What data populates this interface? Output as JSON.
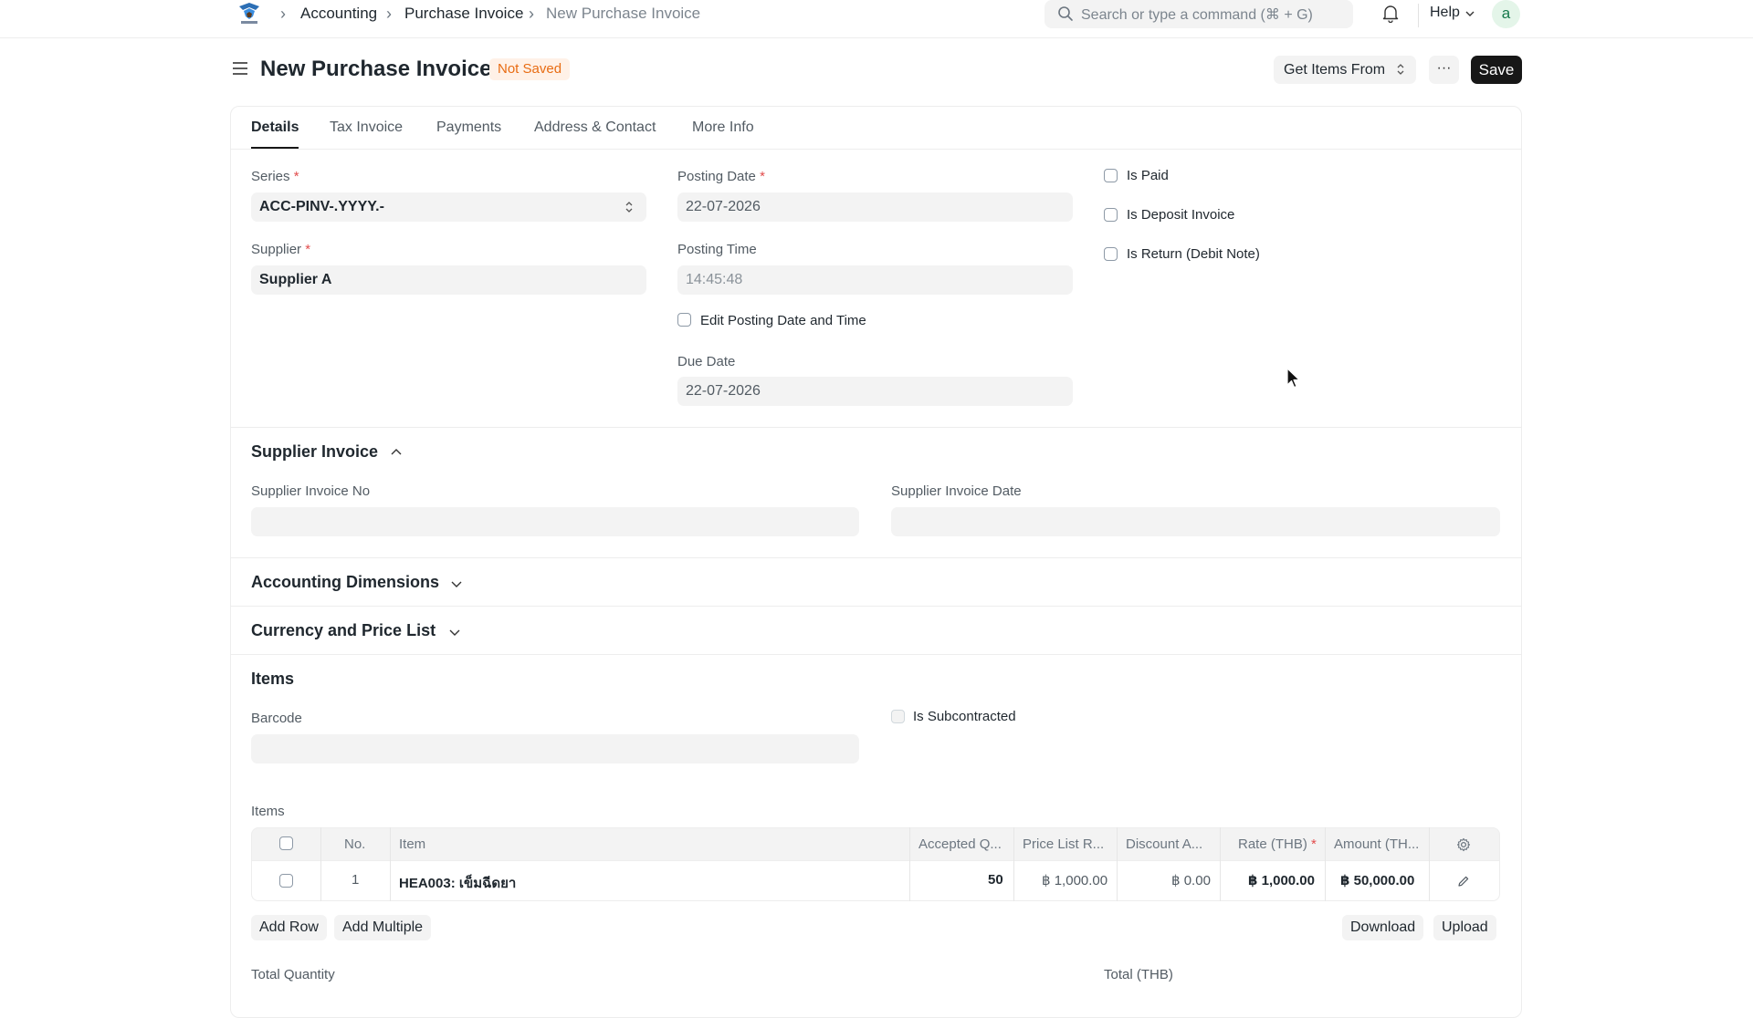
{
  "navbar": {
    "breadcrumbs": [
      "Accounting",
      "Purchase Invoice",
      "New Purchase Invoice"
    ],
    "search_placeholder": "Search or type a command (⌘ + G)",
    "help_label": "Help",
    "avatar_letter": "a"
  },
  "page": {
    "title": "New Purchase Invoice",
    "status": "Not Saved",
    "get_items_label": "Get Items From",
    "more_label": "···",
    "save_label": "Save"
  },
  "tabs": [
    "Details",
    "Tax Invoice",
    "Payments",
    "Address & Contact",
    "More Info"
  ],
  "details": {
    "series_label": "Series",
    "series_value": "ACC-PINV-.YYYY.-",
    "supplier_label": "Supplier",
    "supplier_value": "Supplier A",
    "posting_date_label": "Posting Date",
    "posting_date_value": "22-07-2026",
    "posting_time_label": "Posting Time",
    "posting_time_value": "14:45:48",
    "edit_posting_label": "Edit Posting Date and Time",
    "due_date_label": "Due Date",
    "due_date_value": "22-07-2026",
    "is_paid_label": "Is Paid",
    "is_deposit_label": "Is Deposit Invoice",
    "is_return_label": "Is Return (Debit Note)"
  },
  "supplier_invoice": {
    "title": "Supplier Invoice",
    "no_label": "Supplier Invoice No",
    "date_label": "Supplier Invoice Date"
  },
  "sections": {
    "accounting_dimensions": "Accounting Dimensions",
    "currency_price_list": "Currency and Price List",
    "items": "Items"
  },
  "items_section": {
    "barcode_label": "Barcode",
    "subcontracted_label": "Is Subcontracted",
    "table_label": "Items",
    "columns": [
      "No.",
      "Item",
      "Accepted Q...",
      "Price List R...",
      "Discount A...",
      "Rate (THB)",
      "Amount (TH..."
    ],
    "rows": [
      {
        "no": "1",
        "item": "HEA003: เข็มฉีดยา",
        "accepted_qty": "50",
        "price_list_rate": "฿ 1,000.00",
        "discount_amount": "฿ 0.00",
        "rate": "฿ 1,000.00",
        "amount": "฿ 50,000.00"
      }
    ],
    "add_row_label": "Add Row",
    "add_multiple_label": "Add Multiple",
    "download_label": "Download",
    "upload_label": "Upload",
    "total_quantity_label": "Total Quantity",
    "total_label": "Total (THB)"
  },
  "colors": {
    "primary_button": "#171717",
    "status_badge_bg": "#fff1e7",
    "status_badge_text": "#e86c13",
    "required_marker": "#e24c4c",
    "avatar_bg": "#e4f5e9"
  },
  "icons": [
    "app-logo-icon",
    "chevron-right-icon",
    "search-icon",
    "bell-icon",
    "chevron-down-icon",
    "hamburger-menu-icon",
    "sort-icon",
    "chevron-up-icon",
    "settings-gear-icon",
    "edit-pencil-icon",
    "mouse-cursor-icon"
  ]
}
